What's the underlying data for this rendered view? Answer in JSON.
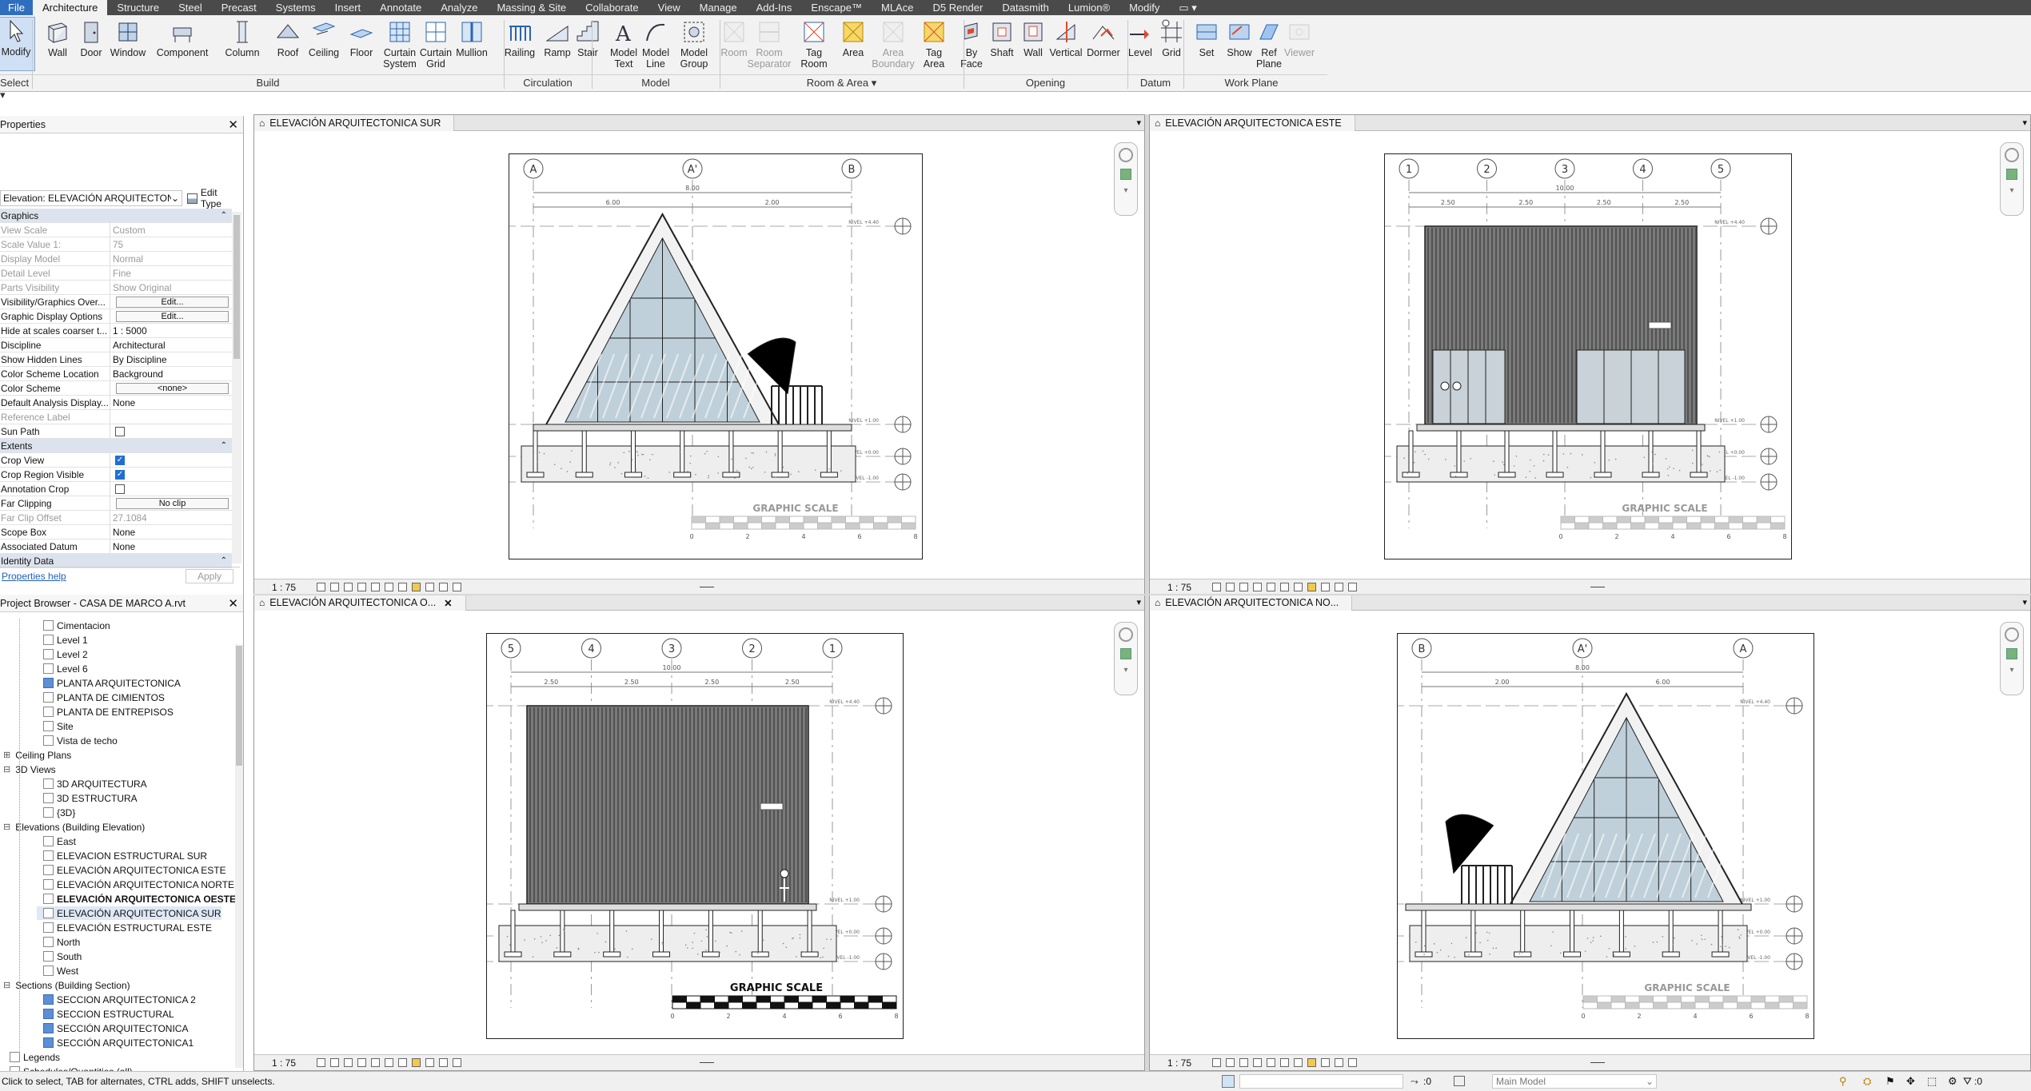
{
  "menu": [
    "File",
    "Architecture",
    "Structure",
    "Steel",
    "Precast",
    "Systems",
    "Insert",
    "Annotate",
    "Analyze",
    "Massing & Site",
    "Collaborate",
    "View",
    "Manage",
    "Add-Ins",
    "Enscape™",
    "MLAce",
    "D5 Render",
    "Datasmith",
    "Lumion®",
    "Modify",
    "▭ ▾"
  ],
  "menu_active": "Architecture",
  "ribbon": {
    "buttons": [
      {
        "label": "Modify",
        "icon": "cursor-icon"
      },
      {
        "label": "Wall",
        "icon": "wall-icon"
      },
      {
        "label": "Door",
        "icon": "door-icon"
      },
      {
        "label": "Window",
        "icon": "window-icon"
      },
      {
        "label": "Component",
        "icon": "component-icon"
      },
      {
        "label": "Column",
        "icon": "column-icon"
      },
      {
        "label": "Roof",
        "icon": "roof-icon"
      },
      {
        "label": "Ceiling",
        "icon": "ceiling-icon"
      },
      {
        "label": "Floor",
        "icon": "floor-icon"
      },
      {
        "label": "Curtain\nSystem",
        "icon": "curtain-system-icon"
      },
      {
        "label": "Curtain\nGrid",
        "icon": "curtain-grid-icon"
      },
      {
        "label": "Mullion",
        "icon": "mullion-icon"
      },
      {
        "label": "Railing",
        "icon": "railing-icon"
      },
      {
        "label": "Ramp",
        "icon": "ramp-icon"
      },
      {
        "label": "Stair",
        "icon": "stair-icon"
      },
      {
        "label": "Model\nText",
        "icon": "model-text-icon"
      },
      {
        "label": "Model\nLine",
        "icon": "model-line-icon"
      },
      {
        "label": "Model\nGroup",
        "icon": "model-group-icon"
      },
      {
        "label": "Room",
        "icon": "room-icon",
        "disabled": true
      },
      {
        "label": "Room\nSeparator",
        "icon": "room-separator-icon",
        "disabled": true
      },
      {
        "label": "Tag\nRoom",
        "icon": "tag-room-icon"
      },
      {
        "label": "Area",
        "icon": "area-icon"
      },
      {
        "label": "Area\nBoundary",
        "icon": "area-boundary-icon",
        "disabled": true
      },
      {
        "label": "Tag\nArea",
        "icon": "tag-area-icon"
      },
      {
        "label": "By\nFace",
        "icon": "by-face-icon"
      },
      {
        "label": "Shaft",
        "icon": "shaft-icon"
      },
      {
        "label": "Wall",
        "icon": "wall-opening-icon"
      },
      {
        "label": "Vertical",
        "icon": "vertical-icon"
      },
      {
        "label": "Dormer",
        "icon": "dormer-icon"
      },
      {
        "label": "Level",
        "icon": "level-icon"
      },
      {
        "label": "Grid",
        "icon": "grid-icon"
      },
      {
        "label": "Set",
        "icon": "set-icon"
      },
      {
        "label": "Show",
        "icon": "show-icon"
      },
      {
        "label": "Ref\nPlane",
        "icon": "ref-plane-icon"
      },
      {
        "label": "Viewer",
        "icon": "viewer-icon",
        "disabled": true
      }
    ],
    "groups": [
      "Select ▾",
      "Build",
      "Circulation",
      "Model",
      "Room & Area ▾",
      "Opening",
      "Datum",
      "Work Plane"
    ]
  },
  "properties": {
    "title": "Properties",
    "type_selector": "Elevation: ELEVACIÓN ARQUITECTONICA",
    "edit_type": "Edit Type",
    "sections": {
      "graphics": "Graphics",
      "extents": "Extents",
      "identity": "Identity Data"
    },
    "rows": [
      [
        "View Scale",
        "Custom"
      ],
      [
        "Scale Value    1:",
        "75"
      ],
      [
        "Display Model",
        "Normal"
      ],
      [
        "Detail Level",
        "Fine"
      ],
      [
        "Parts Visibility",
        "Show Original"
      ],
      [
        "Visibility/Graphics Over...",
        "Edit..."
      ],
      [
        "Graphic Display Options",
        "Edit..."
      ],
      [
        "Hide at scales coarser t...",
        "1 : 5000"
      ],
      [
        "Discipline",
        "Architectural"
      ],
      [
        "Show Hidden Lines",
        "By Discipline"
      ],
      [
        "Color Scheme Location",
        "Background"
      ],
      [
        "Color Scheme",
        "<none>"
      ],
      [
        "Default Analysis Display...",
        "None"
      ],
      [
        "Reference Label",
        ""
      ],
      [
        "Sun Path",
        ""
      ],
      [
        "Crop View",
        ""
      ],
      [
        "Crop Region Visible",
        ""
      ],
      [
        "Annotation Crop",
        ""
      ],
      [
        "Far Clipping",
        "No clip"
      ],
      [
        "Far Clip Offset",
        "27.1084"
      ],
      [
        "Scope Box",
        "None"
      ],
      [
        "Associated Datum",
        "None"
      ]
    ],
    "help": "Properties help",
    "apply": "Apply"
  },
  "browser": {
    "title": "Project Browser - CASA DE MARCO A.rvt",
    "items": [
      "Cimentacion",
      "Level 1",
      "Level 2",
      "Level 6",
      "PLANTA ARQUITECTONICA",
      "PLANTA DE CIMIENTOS",
      "PLANTA DE ENTREPISOS",
      "Site",
      "Vista de techo",
      "Ceiling Plans",
      "3D Views",
      "3D ARQUITECTURA",
      "3D ESTRUCTURA",
      "{3D}",
      "Elevations (Building Elevation)",
      "East",
      "ELEVACION ESTRUCTURAL SUR",
      "ELEVACIÓN ARQUITECTONICA ESTE",
      "ELEVACIÓN ARQUITECTONICA NORTE",
      "ELEVACIÓN ARQUITECTONICA OESTE",
      "ELEVACIÓN ARQUITECTONICA SUR",
      "ELEVACIÓN ESTRUCTURAL ESTE",
      "North",
      "South",
      "West",
      "Sections (Building Section)",
      "SECCION ARQUITECTONICA 2",
      "SECCION ESTRUCTURAL",
      "SECCIÓN ARQUITECTONICA",
      "SECCIÓN ARQUITECTONICA1",
      "Legends",
      "Schedules/Quantities (all)"
    ]
  },
  "views": [
    {
      "title": "ELEVACIÓN ARQUITECTONICA SUR",
      "scale": "1 : 75",
      "grids": [
        "A",
        "A'",
        "B"
      ],
      "dims": [
        "8.00",
        "6.00",
        "2.00"
      ],
      "levels": [
        "NIVEL +4.40",
        "NIVEL +1.00",
        "NIVEL +0.00",
        "NIVEL -1.00"
      ],
      "scale_title": "GRAPHIC SCALE",
      "scale_ticks": [
        "0",
        "2",
        "4",
        "6",
        "8"
      ]
    },
    {
      "title": "ELEVACIÓN ARQUITECTONICA ESTE",
      "scale": "1 : 75",
      "grids": [
        "1",
        "2",
        "3",
        "4",
        "5"
      ],
      "dims": [
        "10.00",
        "2.50",
        "2.50",
        "2.50",
        "2.50"
      ],
      "levels": [
        "NIVEL +4.40",
        "NIVEL +1.00",
        "NIVEL +0.00",
        "NIVEL -1.00"
      ],
      "scale_title": "GRAPHIC SCALE",
      "scale_ticks": [
        "0",
        "2",
        "4",
        "6",
        "8"
      ]
    },
    {
      "title": "ELEVACIÓN ARQUITECTONICA O...",
      "scale": "1 : 75",
      "grids": [
        "5",
        "4",
        "3",
        "2",
        "1"
      ],
      "dims": [
        "10.00",
        "2.50",
        "2.50",
        "2.50",
        "2.50"
      ],
      "levels": [
        "NIVEL +4.40",
        "NIVEL +1.00",
        "NIVEL +0.00",
        "NIVEL -1.00"
      ],
      "scale_title": "GRAPHIC SCALE",
      "scale_ticks": [
        "0",
        "2",
        "4",
        "6",
        "8"
      ]
    },
    {
      "title": "ELEVACIÓN ARQUITECTONICA NO...",
      "scale": "1 : 75",
      "grids": [
        "B",
        "A'",
        "A"
      ],
      "dims": [
        "8.00",
        "2.00",
        "6.00"
      ],
      "levels": [
        "NIVEL +4.40",
        "NIVEL +1.00",
        "NIVEL +0.00",
        "NIVEL -1.00"
      ],
      "scale_title": "GRAPHIC SCALE",
      "scale_ticks": [
        "0",
        "2",
        "4",
        "6",
        "8"
      ]
    }
  ],
  "status": {
    "hint": "Click to select, TAB for alternates, CTRL adds, SHIFT unselects.",
    "zero": ":0",
    "model": "Main Model",
    "filter": ":0"
  }
}
